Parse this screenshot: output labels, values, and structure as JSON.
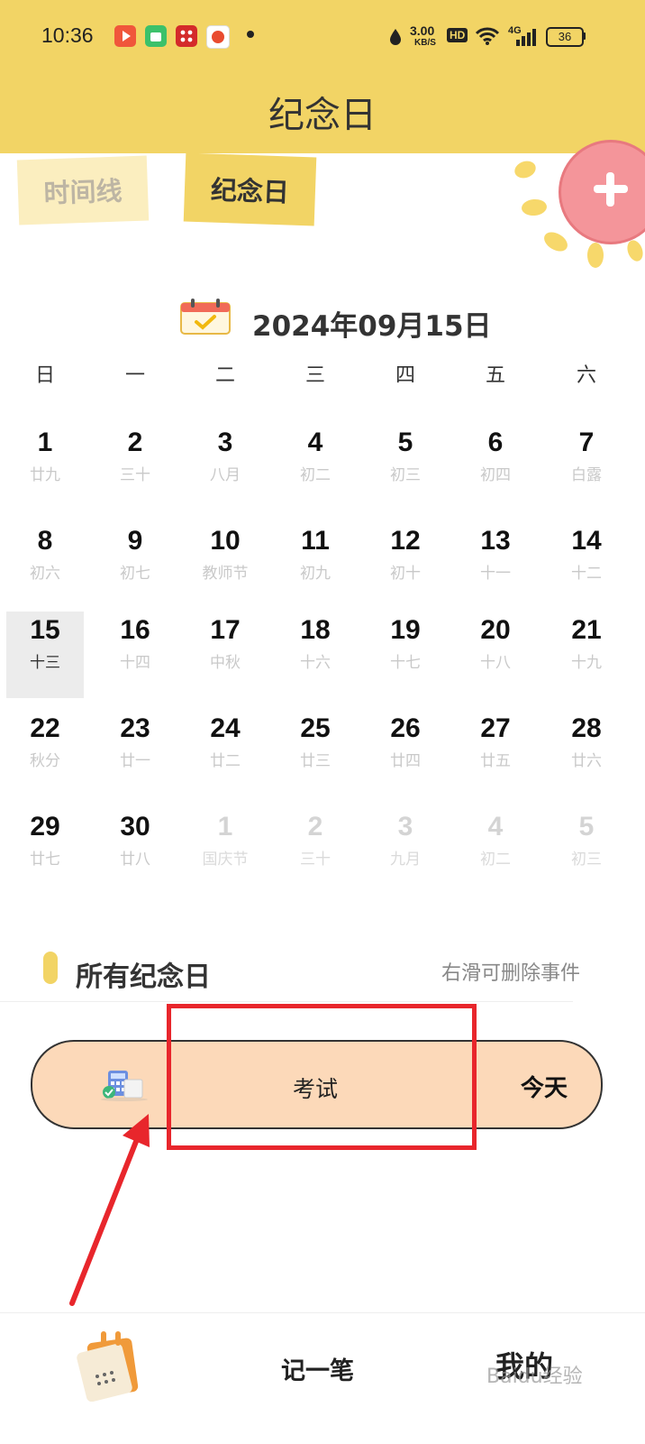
{
  "status_bar": {
    "time": "10:36",
    "network_speed": "3.00",
    "speed_unit": "KB/S",
    "hd_label": "HD",
    "signal_label": "4G",
    "battery": "36"
  },
  "header": {
    "title": "纪念日"
  },
  "tabs": [
    {
      "label": "时间线",
      "active": false
    },
    {
      "label": "纪念日",
      "active": true
    }
  ],
  "add_button_icon": "plus-icon",
  "calendar": {
    "date_label": "2024年09月15日",
    "weekdays": [
      "日",
      "一",
      "二",
      "三",
      "四",
      "五",
      "六"
    ],
    "weeks": [
      [
        {
          "d": "1",
          "l": "廿九"
        },
        {
          "d": "2",
          "l": "三十"
        },
        {
          "d": "3",
          "l": "八月"
        },
        {
          "d": "4",
          "l": "初二"
        },
        {
          "d": "5",
          "l": "初三"
        },
        {
          "d": "6",
          "l": "初四"
        },
        {
          "d": "7",
          "l": "白露"
        }
      ],
      [
        {
          "d": "8",
          "l": "初六"
        },
        {
          "d": "9",
          "l": "初七"
        },
        {
          "d": "10",
          "l": "教师节"
        },
        {
          "d": "11",
          "l": "初九"
        },
        {
          "d": "12",
          "l": "初十"
        },
        {
          "d": "13",
          "l": "十一"
        },
        {
          "d": "14",
          "l": "十二"
        }
      ],
      [
        {
          "d": "15",
          "l": "十三",
          "today": true
        },
        {
          "d": "16",
          "l": "十四"
        },
        {
          "d": "17",
          "l": "中秋"
        },
        {
          "d": "18",
          "l": "十六"
        },
        {
          "d": "19",
          "l": "十七"
        },
        {
          "d": "20",
          "l": "十八"
        },
        {
          "d": "21",
          "l": "十九"
        }
      ],
      [
        {
          "d": "22",
          "l": "秋分"
        },
        {
          "d": "23",
          "l": "廿一"
        },
        {
          "d": "24",
          "l": "廿二"
        },
        {
          "d": "25",
          "l": "廿三"
        },
        {
          "d": "26",
          "l": "廿四"
        },
        {
          "d": "27",
          "l": "廿五"
        },
        {
          "d": "28",
          "l": "廿六"
        }
      ],
      [
        {
          "d": "29",
          "l": "廿七"
        },
        {
          "d": "30",
          "l": "廿八"
        },
        {
          "d": "1",
          "l": "国庆节",
          "other": true
        },
        {
          "d": "2",
          "l": "三十",
          "other": true
        },
        {
          "d": "3",
          "l": "九月",
          "other": true
        },
        {
          "d": "4",
          "l": "初二",
          "other": true
        },
        {
          "d": "5",
          "l": "初三",
          "other": true
        }
      ]
    ]
  },
  "section": {
    "title": "所有纪念日",
    "hint": "右滑可删除事件"
  },
  "events": [
    {
      "name": "考试",
      "when": "今天",
      "icon": "calculator-icon"
    }
  ],
  "bottom_nav": {
    "record_label": "记一笔",
    "mine_label": "我的"
  },
  "watermark": "Baidu经验",
  "colors": {
    "header": "#f2d465",
    "event_card": "#fcd9b9",
    "add_button": "#f4959a",
    "annotation": "#e8262c"
  }
}
